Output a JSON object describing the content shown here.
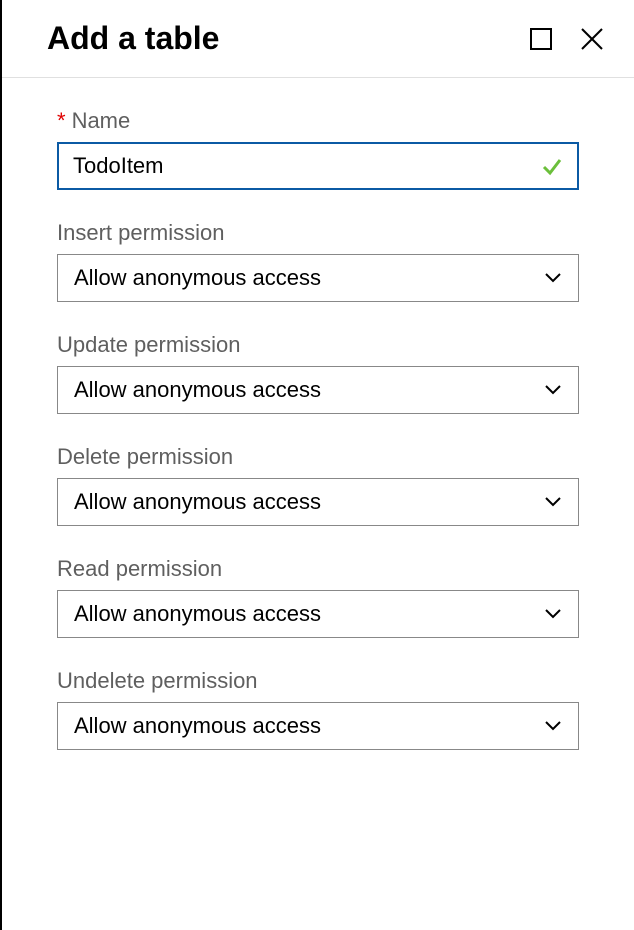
{
  "header": {
    "title": "Add a table"
  },
  "fields": {
    "name": {
      "label": "Name",
      "value": "TodoItem",
      "required": true
    },
    "insert": {
      "label": "Insert permission",
      "value": "Allow anonymous access"
    },
    "update": {
      "label": "Update permission",
      "value": "Allow anonymous access"
    },
    "delete": {
      "label": "Delete permission",
      "value": "Allow anonymous access"
    },
    "read": {
      "label": "Read permission",
      "value": "Allow anonymous access"
    },
    "undelete": {
      "label": "Undelete permission",
      "value": "Allow anonymous access"
    }
  }
}
